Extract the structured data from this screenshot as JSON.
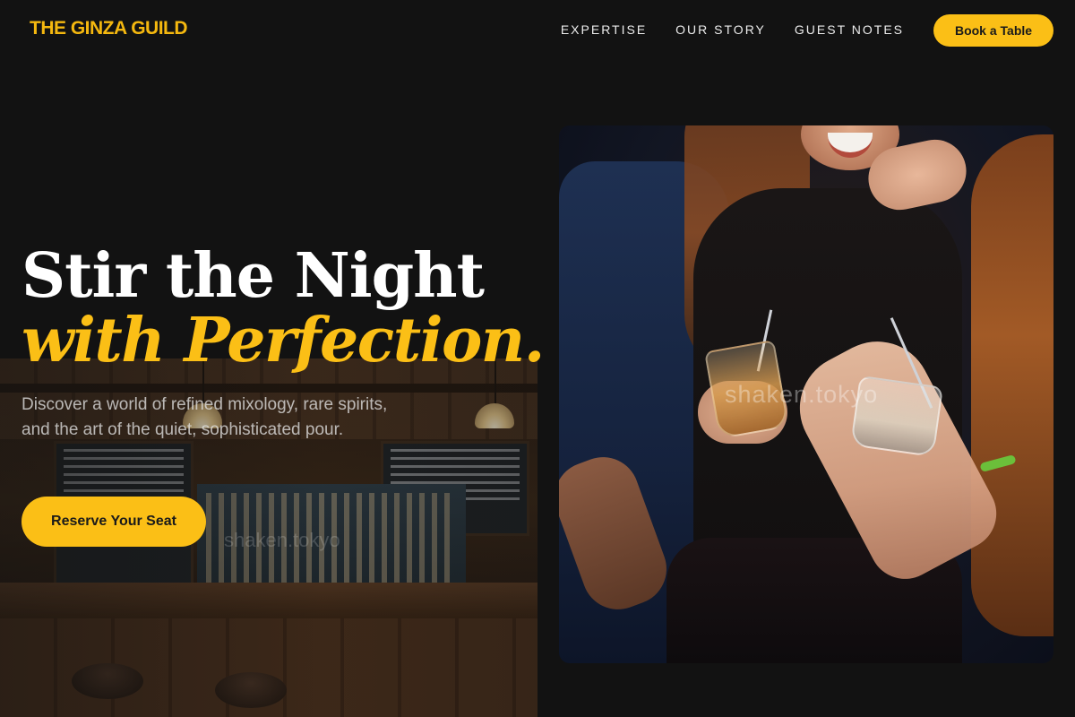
{
  "header": {
    "brand": "THE GINZA GUILD",
    "nav": [
      {
        "label": "EXPERTISE"
      },
      {
        "label": "OUR STORY"
      },
      {
        "label": "GUEST NOTES"
      }
    ],
    "cta_label": "Book a Table"
  },
  "hero": {
    "title_line1": "Stir the Night",
    "title_line2": "with Perfection.",
    "description": "Discover a world of refined mixology, rare spirits, and the art of the quiet, sophisticated pour.",
    "cta_label": "Reserve Your Seat"
  },
  "images": {
    "bar_watermark": "shaken.tokyo",
    "photo_watermark": "shaken.tokyo"
  },
  "colors": {
    "background": "#121212",
    "accent": "#fbbf16",
    "brand": "#f5b80f",
    "text_primary": "#ffffff"
  }
}
